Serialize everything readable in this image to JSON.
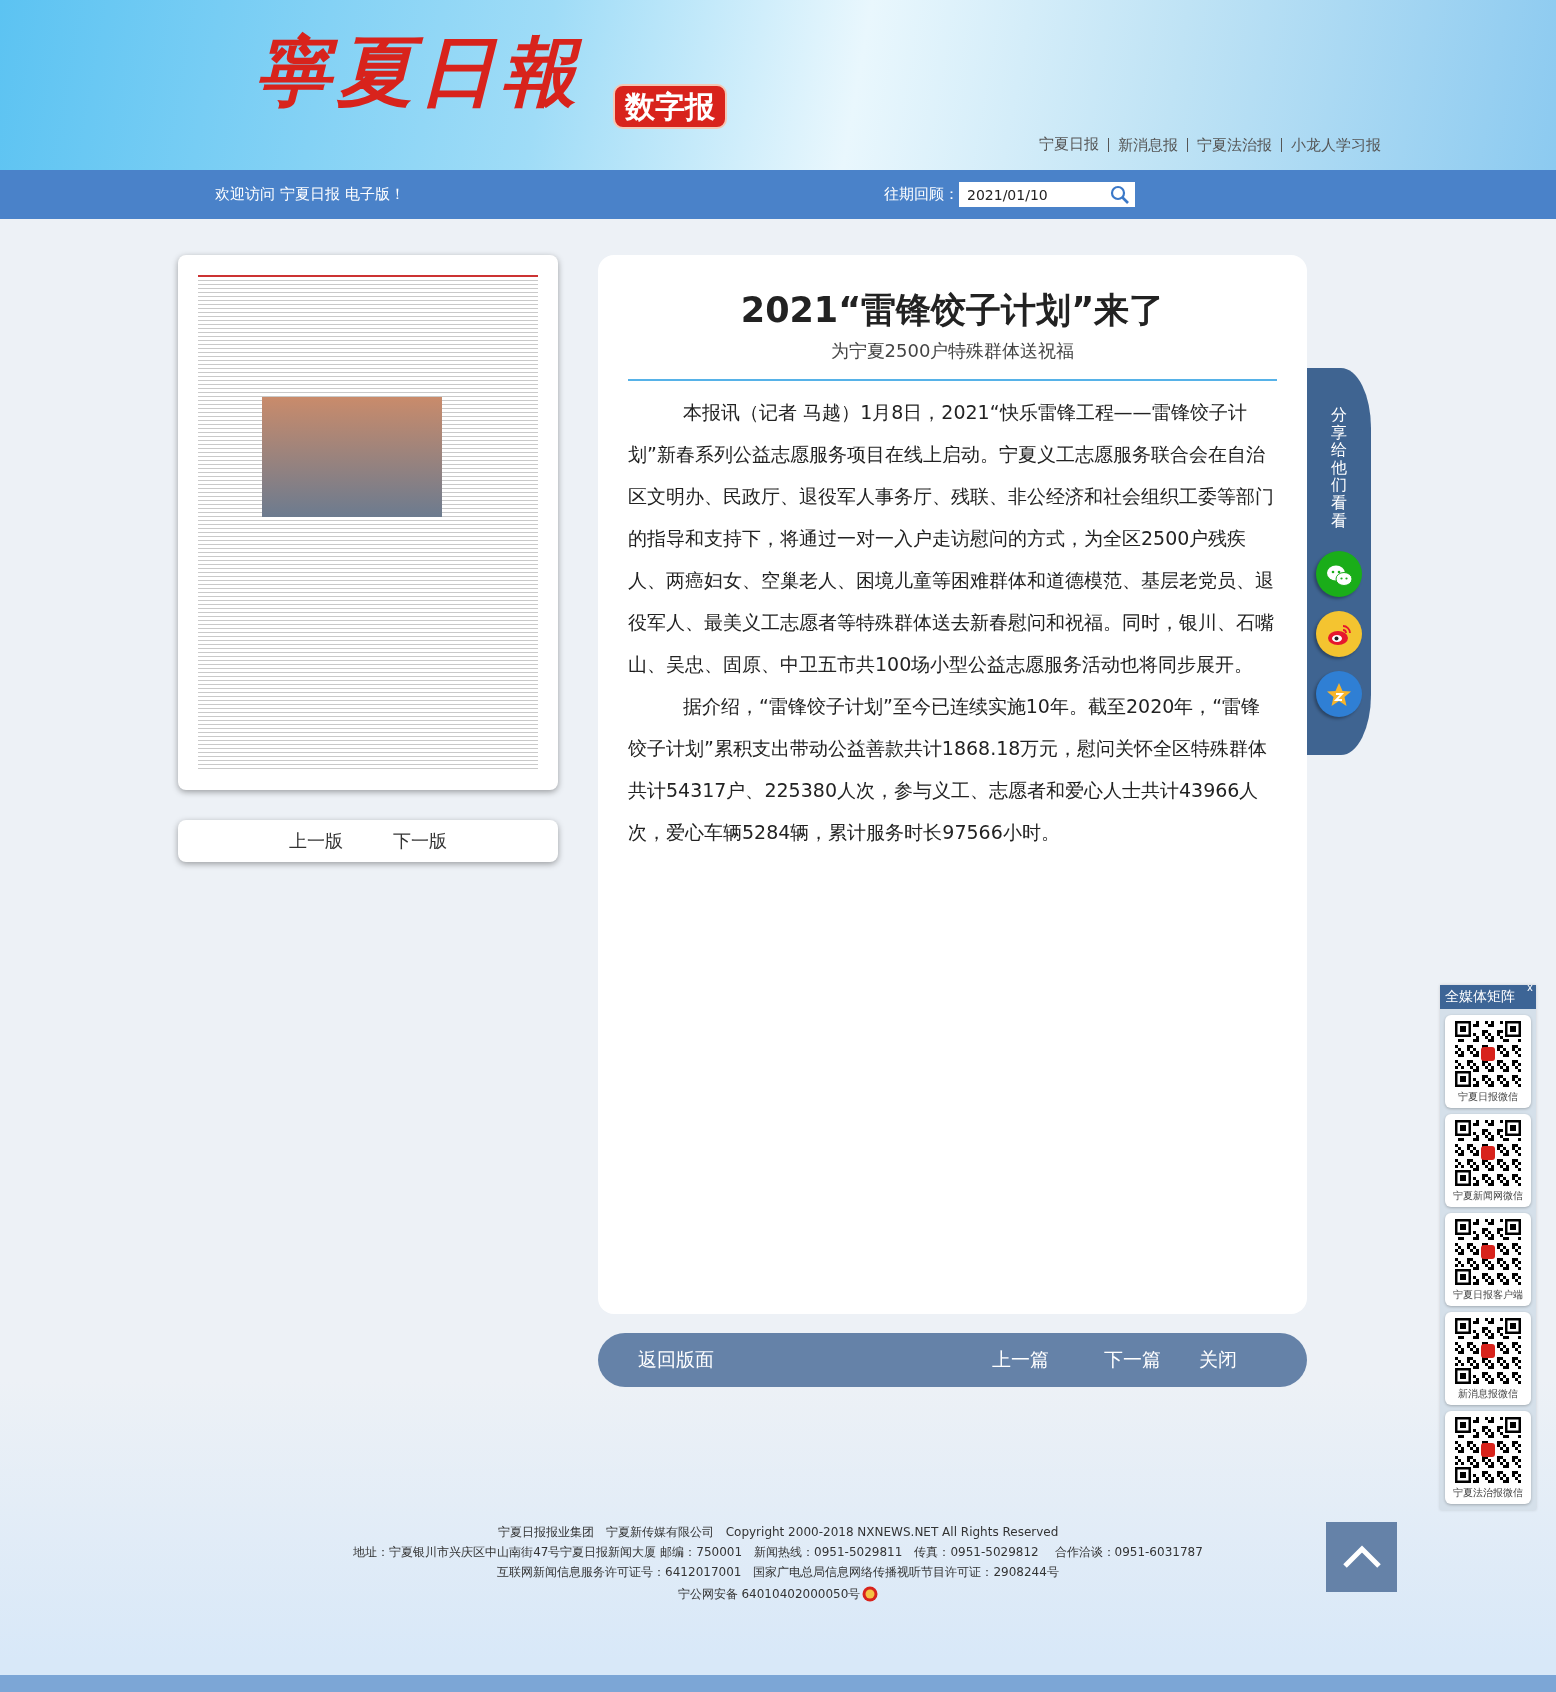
{
  "header": {
    "logo": "寧夏日報",
    "badge": "数字报",
    "links": [
      "宁夏日报",
      "新消息报",
      "宁夏法治报",
      "小龙人学习报"
    ]
  },
  "top_bar": {
    "welcome": "欢迎访问 宁夏日报 电子版！",
    "archive_label": "往期回顾：",
    "date_field": {
      "value": "2021/01/10"
    }
  },
  "page_viewer": {
    "prev": "上一版",
    "next": "下一版"
  },
  "article": {
    "title": "2021“雷锋饺子计划”来了",
    "subtitle": "为宁夏2500户特殊群体送祝福",
    "paragraphs": [
      "本报讯（记者 马越）1月8日，2021“快乐雷锋工程——雷锋饺子计划”新春系列公益志愿服务项目在线上启动。宁夏义工志愿服务联合会在自治区文明办、民政厅、退役军人事务厅、残联、非公经济和社会组织工委等部门的指导和支持下，将通过一对一入户走访慰问的方式，为全区2500户残疾人、两癌妇女、空巢老人、困境儿童等困难群体和道德模范、基层老党员、退役军人、最美义工志愿者等特殊群体送去新春慰问和祝福。同时，银川、石嘴山、吴忠、固原、中卫五市共100场小型公益志愿服务活动也将同步展开。",
      "据介绍，“雷锋饺子计划”至今已连续实施10年。截至2020年，“雷锋饺子计划”累积支出带动公益善款共计1868.18万元，慰问关怀全区特殊群体共计54317户、225380人次，参与义工、志愿者和爱心人士共计43966人次，爱心车辆5284辆，累计服务时长97566小时。"
    ]
  },
  "article_nav": {
    "back": "返回版面",
    "prev": "上一篇",
    "next": "下一篇",
    "close": "关闭"
  },
  "share": {
    "label": "分享给他们看看",
    "buttons": [
      {
        "kind": "wechat"
      },
      {
        "kind": "weibo"
      },
      {
        "kind": "qzone"
      }
    ]
  },
  "media_matrix": {
    "title": "全媒体矩阵",
    "close": "x",
    "items": [
      {
        "label": "宁夏日报微信"
      },
      {
        "label": "宁夏新闻网微信"
      },
      {
        "label": "宁夏日报客户端"
      },
      {
        "label": "新消息报微信"
      },
      {
        "label": "宁夏法治报微信"
      }
    ]
  },
  "footer": {
    "lines": [
      "宁夏日报报业集团　宁夏新传媒有限公司　Copyright 2000-2018 NXNEWS.NET All Rights Reserved",
      "地址：宁夏银川市兴庆区中山南街47号宁夏日报新闻大厦 邮编：750001　新闻热线：0951-5029811　传真：0951-5029812　 合作洽谈：0951-6031787",
      "互联网新闻信息服务许可证号：6412017001　国家广电总局信息网络传播视听节目许可证：2908244号"
    ],
    "police_record": "宁公网安备 64010402000050号"
  }
}
